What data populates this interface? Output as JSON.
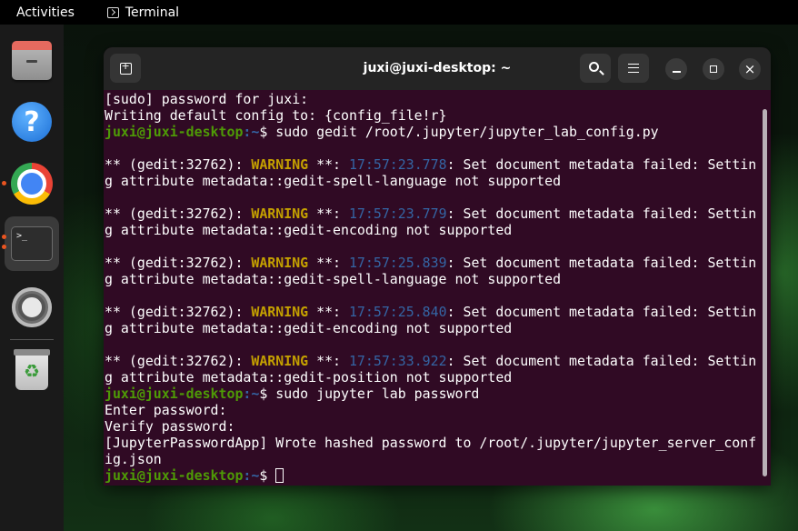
{
  "topbar": {
    "activities": "Activities",
    "app_name": "Terminal"
  },
  "dock": {
    "items": [
      {
        "name": "files",
        "icon": "files-icon"
      },
      {
        "name": "help",
        "icon": "help-icon",
        "glyph": "?"
      },
      {
        "name": "chrome",
        "icon": "chrome-icon"
      },
      {
        "name": "terminal",
        "icon": "terminal-icon",
        "glyph": ">_"
      },
      {
        "name": "settings",
        "icon": "settings-icon"
      },
      {
        "name": "trash",
        "icon": "trash-icon",
        "glyph": "♻"
      }
    ]
  },
  "window": {
    "title": "juxi@juxi-desktop: ~",
    "buttons": {
      "new_tab": "new-tab-icon",
      "search": "search-icon",
      "menu": "menu-icon",
      "minimize": "minimize-icon",
      "maximize": "maximize-icon",
      "close": "×"
    }
  },
  "terminal": {
    "user_host": "juxi@juxi-desktop",
    "path": ":~",
    "lines": [
      [
        {
          "t": "[sudo] password for juxi:",
          "c": ""
        }
      ],
      [
        {
          "t": "Writing default config to: {config_file!r}",
          "c": ""
        }
      ],
      [
        {
          "t": "juxi@juxi-desktop",
          "c": "prompt"
        },
        {
          "t": ":~",
          "c": "path"
        },
        {
          "t": "$ sudo gedit /root/.jupyter/jupyter_lab_config.py",
          "c": ""
        }
      ],
      [],
      [
        {
          "t": "** (gedit:32762): ",
          "c": ""
        },
        {
          "t": "WARNING",
          "c": "warn"
        },
        {
          "t": " **: ",
          "c": ""
        },
        {
          "t": "17:57:23.778",
          "c": "ts"
        },
        {
          "t": ": Set document metadata failed: Settin",
          "c": ""
        }
      ],
      [
        {
          "t": "g attribute metadata::gedit-spell-language not supported",
          "c": ""
        }
      ],
      [],
      [
        {
          "t": "** (gedit:32762): ",
          "c": ""
        },
        {
          "t": "WARNING",
          "c": "warn"
        },
        {
          "t": " **: ",
          "c": ""
        },
        {
          "t": "17:57:23.779",
          "c": "ts"
        },
        {
          "t": ": Set document metadata failed: Settin",
          "c": ""
        }
      ],
      [
        {
          "t": "g attribute metadata::gedit-encoding not supported",
          "c": ""
        }
      ],
      [],
      [
        {
          "t": "** (gedit:32762): ",
          "c": ""
        },
        {
          "t": "WARNING",
          "c": "warn"
        },
        {
          "t": " **: ",
          "c": ""
        },
        {
          "t": "17:57:25.839",
          "c": "ts"
        },
        {
          "t": ": Set document metadata failed: Settin",
          "c": ""
        }
      ],
      [
        {
          "t": "g attribute metadata::gedit-spell-language not supported",
          "c": ""
        }
      ],
      [],
      [
        {
          "t": "** (gedit:32762): ",
          "c": ""
        },
        {
          "t": "WARNING",
          "c": "warn"
        },
        {
          "t": " **: ",
          "c": ""
        },
        {
          "t": "17:57:25.840",
          "c": "ts"
        },
        {
          "t": ": Set document metadata failed: Settin",
          "c": ""
        }
      ],
      [
        {
          "t": "g attribute metadata::gedit-encoding not supported",
          "c": ""
        }
      ],
      [],
      [
        {
          "t": "** (gedit:32762): ",
          "c": ""
        },
        {
          "t": "WARNING",
          "c": "warn"
        },
        {
          "t": " **: ",
          "c": ""
        },
        {
          "t": "17:57:33.922",
          "c": "ts"
        },
        {
          "t": ": Set document metadata failed: Settin",
          "c": ""
        }
      ],
      [
        {
          "t": "g attribute metadata::gedit-position not supported",
          "c": ""
        }
      ],
      [
        {
          "t": "juxi@juxi-desktop",
          "c": "prompt"
        },
        {
          "t": ":~",
          "c": "path"
        },
        {
          "t": "$ sudo jupyter lab password",
          "c": ""
        }
      ],
      [
        {
          "t": "Enter password:",
          "c": ""
        }
      ],
      [
        {
          "t": "Verify password:",
          "c": ""
        }
      ],
      [
        {
          "t": "[JupyterPasswordApp] Wrote hashed password to /root/.jupyter/jupyter_server_conf",
          "c": ""
        }
      ],
      [
        {
          "t": "ig.json",
          "c": ""
        }
      ],
      [
        {
          "t": "juxi@juxi-desktop",
          "c": "prompt"
        },
        {
          "t": ":~",
          "c": "path"
        },
        {
          "t": "$ ",
          "c": ""
        },
        {
          "t": "",
          "c": "cursor"
        }
      ]
    ]
  }
}
